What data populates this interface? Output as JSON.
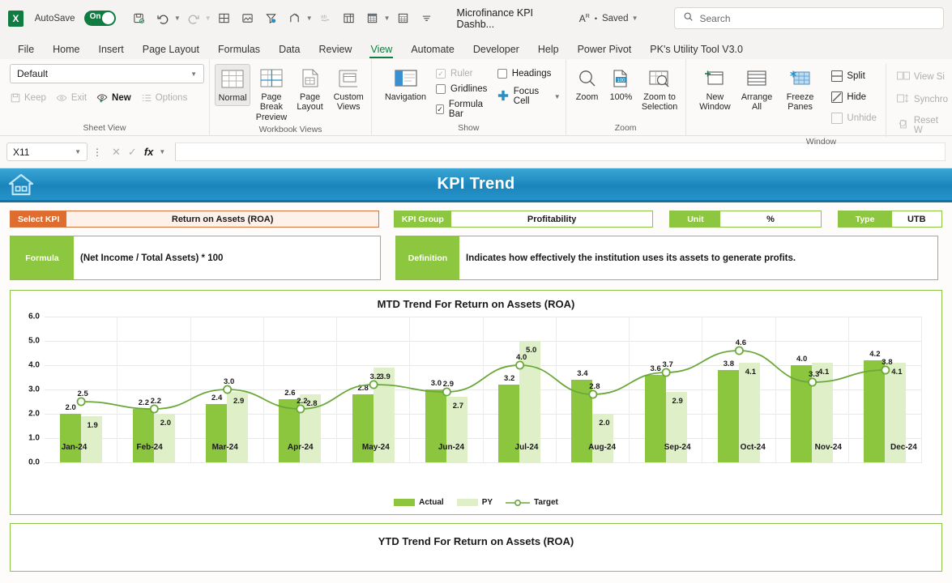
{
  "titlebar": {
    "app_icon": "excel-logo",
    "autosave_label": "AutoSave",
    "autosave_state": "On",
    "document_title": "Microfinance KPI Dashb...",
    "save_status": "Saved",
    "search_placeholder": "Search",
    "qat_icons": [
      "save-icon",
      "undo-icon",
      "redo-icon",
      "borders-icon",
      "open-picture-icon",
      "filter-icon",
      "share-icon",
      "spelling-icon",
      "table-icon",
      "calculate-sheet-icon",
      "calculate-now-icon",
      "customize-qat-icon"
    ]
  },
  "ribbon": {
    "tabs": [
      {
        "label": "File",
        "active": false
      },
      {
        "label": "Home",
        "active": false
      },
      {
        "label": "Insert",
        "active": false
      },
      {
        "label": "Page Layout",
        "active": false
      },
      {
        "label": "Formulas",
        "active": false
      },
      {
        "label": "Data",
        "active": false
      },
      {
        "label": "Review",
        "active": false
      },
      {
        "label": "View",
        "active": true
      },
      {
        "label": "Automate",
        "active": false
      },
      {
        "label": "Developer",
        "active": false
      },
      {
        "label": "Help",
        "active": false
      },
      {
        "label": "Power Pivot",
        "active": false
      },
      {
        "label": "PK's Utility Tool V3.0",
        "active": false
      }
    ],
    "sheet_view": {
      "group_title": "Sheet View",
      "select_value": "Default",
      "keep": "Keep",
      "exit": "Exit",
      "new": "New",
      "options": "Options"
    },
    "workbook_views": {
      "group_title": "Workbook Views",
      "normal": "Normal",
      "page_break_preview": "Page Break Preview",
      "page_layout": "Page Layout",
      "custom_views": "Custom Views"
    },
    "show": {
      "group_title": "Show",
      "navigation": "Navigation",
      "ruler": "Ruler",
      "gridlines": "Gridlines",
      "formula_bar": "Formula Bar",
      "headings": "Headings",
      "focus_cell": "Focus Cell",
      "ruler_checked": true,
      "gridlines_checked": false,
      "formula_bar_checked": true,
      "headings_checked": false
    },
    "zoom": {
      "group_title": "Zoom",
      "zoom": "Zoom",
      "level": "100%",
      "zoom_to_selection": "Zoom to Selection"
    },
    "window": {
      "group_title": "Window",
      "new_window": "New Window",
      "arrange_all": "Arrange All",
      "freeze_panes": "Freeze Panes",
      "split": "Split",
      "hide": "Hide",
      "unhide": "Unhide",
      "view_side_by_side": "View Si",
      "synchronous_scrolling": "Synchro",
      "reset_window": "Reset W"
    }
  },
  "formula_bar": {
    "name_box": "X11",
    "cancel_icon": "cancel-icon",
    "enter_icon": "enter-icon",
    "fx_icon": "insert-function-icon",
    "formula_value": ""
  },
  "dashboard": {
    "home_icon": "home-icon",
    "banner_title": "KPI Trend",
    "chips": [
      {
        "label": "Select KPI",
        "value": "Return on Assets (ROA)"
      },
      {
        "label": "KPI Group",
        "value": "Profitability"
      },
      {
        "label": "Unit",
        "value": "%"
      },
      {
        "label": "Type",
        "value": "UTB"
      }
    ],
    "formula_label": "Formula",
    "formula_value": "(Net Income / Total Assets) * 100",
    "definition_label": "Definition",
    "definition_value": "Indicates how effectively the institution uses its assets to generate profits.",
    "ytd_chart_title": "YTD Trend For Return on Assets (ROA)",
    "colors": {
      "banner_blue": "#1b85bb",
      "accent_green": "#8dc63f",
      "accent_orange": "#e06c2d",
      "actual_bar": "#8cc63e",
      "py_bar": "#dff0c8",
      "target_line": "#6aa83a"
    }
  },
  "chart_data": {
    "type": "bar",
    "title": "MTD Trend For Return on Assets (ROA)",
    "xlabel": "",
    "ylabel": "",
    "ylim": [
      0,
      6
    ],
    "yticks": [
      "0.0",
      "1.0",
      "2.0",
      "3.0",
      "4.0",
      "5.0",
      "6.0"
    ],
    "grid": true,
    "legend_position": "bottom",
    "categories": [
      "Jan-24",
      "Feb-24",
      "Mar-24",
      "Apr-24",
      "May-24",
      "Jun-24",
      "Jul-24",
      "Aug-24",
      "Sep-24",
      "Oct-24",
      "Nov-24",
      "Dec-24"
    ],
    "series": [
      {
        "name": "Actual",
        "type": "bar",
        "color": "#8cc63e",
        "values": [
          2.0,
          2.2,
          2.4,
          2.6,
          2.8,
          3.0,
          3.2,
          3.4,
          3.6,
          3.8,
          4.0,
          4.2
        ]
      },
      {
        "name": "PY",
        "type": "bar",
        "color": "#dff0c8",
        "values": [
          1.9,
          2.0,
          2.9,
          2.8,
          3.9,
          2.7,
          5.0,
          2.0,
          2.9,
          4.1,
          4.1,
          4.1
        ]
      },
      {
        "name": "Target",
        "type": "line",
        "color": "#6aa83a",
        "values": [
          2.5,
          2.2,
          3.0,
          2.2,
          3.2,
          2.9,
          4.0,
          2.8,
          3.7,
          4.6,
          3.3,
          3.8
        ]
      }
    ]
  }
}
